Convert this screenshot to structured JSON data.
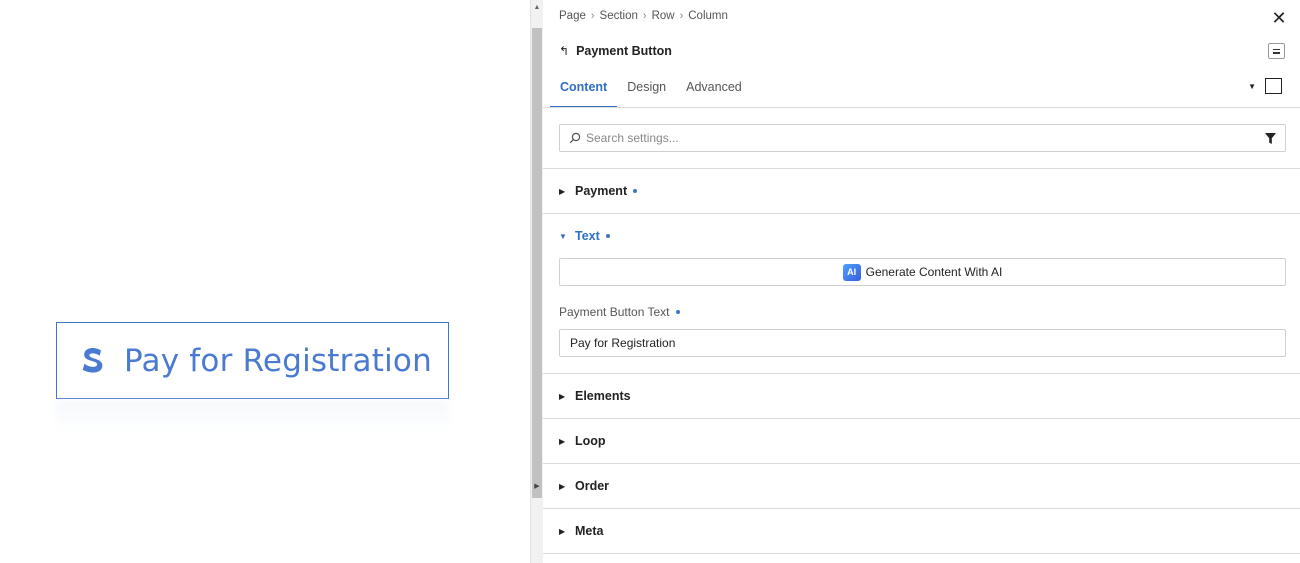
{
  "canvas": {
    "pay_button_label": "Pay for Registration",
    "logo_icon": "stripe-s-icon",
    "accent_color": "#3f74c8"
  },
  "panel": {
    "breadcrumbs": [
      "Page",
      "Section",
      "Row",
      "Column"
    ],
    "title": "Payment Button",
    "tabs": [
      {
        "label": "Content",
        "active": true
      },
      {
        "label": "Design",
        "active": false
      },
      {
        "label": "Advanced",
        "active": false
      }
    ],
    "search": {
      "placeholder": "Search settings...",
      "value": ""
    },
    "sections": {
      "payment": {
        "label": "Payment",
        "modified": true
      },
      "text": {
        "label": "Text",
        "modified": true,
        "expanded": true
      },
      "elements": {
        "label": "Elements"
      },
      "loop": {
        "label": "Loop"
      },
      "order": {
        "label": "Order"
      },
      "meta": {
        "label": "Meta"
      }
    },
    "ai_button": {
      "icon_text": "AI",
      "label": "Generate Content With AI"
    },
    "payment_button_text": {
      "label": "Payment Button Text",
      "value": "Pay for Registration"
    },
    "active_color": "#2f6fc7"
  }
}
